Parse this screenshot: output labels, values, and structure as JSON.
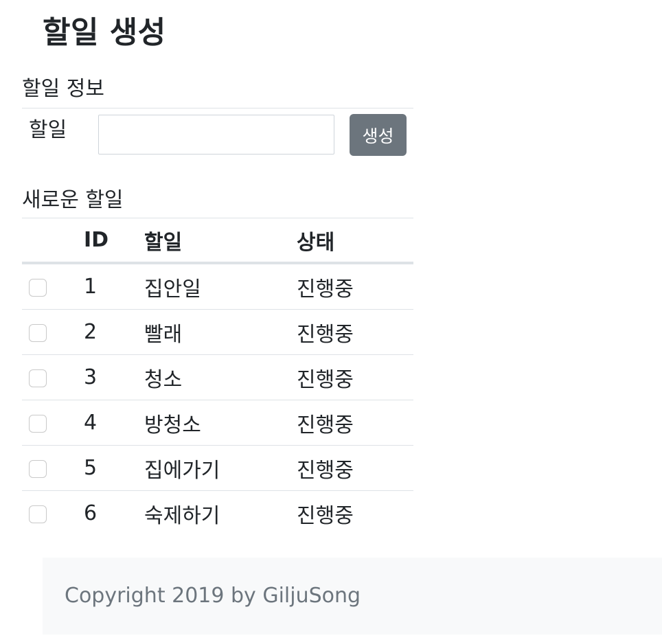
{
  "header": {
    "title": "할일 생성"
  },
  "form": {
    "section_title": "할일 정보",
    "label": "할일",
    "input_value": "",
    "input_placeholder": "",
    "submit_label": "생성"
  },
  "list": {
    "section_title": "새로운 할일",
    "columns": {
      "check": "",
      "id": "ID",
      "task": "할일",
      "status": "상태"
    },
    "rows": [
      {
        "id": "1",
        "task": "집안일",
        "status": "진행중",
        "checked": false
      },
      {
        "id": "2",
        "task": "빨래",
        "status": "진행중",
        "checked": false
      },
      {
        "id": "3",
        "task": "청소",
        "status": "진행중",
        "checked": false
      },
      {
        "id": "4",
        "task": "방청소",
        "status": "진행중",
        "checked": false
      },
      {
        "id": "5",
        "task": "집에가기",
        "status": "진행중",
        "checked": false
      },
      {
        "id": "6",
        "task": "숙제하기",
        "status": "진행중",
        "checked": false
      }
    ]
  },
  "footer": {
    "copyright": "Copyright 2019 by GiljuSong"
  },
  "colors": {
    "button_bg": "#6c757d",
    "footer_bg": "#f8f9fa",
    "footer_text": "#6c757d",
    "border": "#dee2e6"
  }
}
